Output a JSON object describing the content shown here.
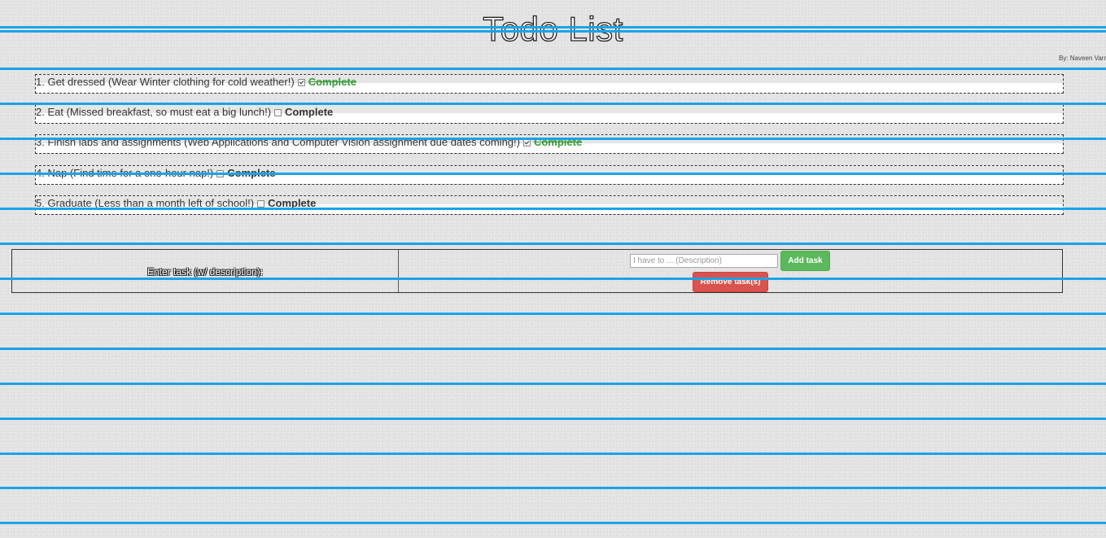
{
  "header": {
    "title": "Todo List",
    "author": "By: Naveen Varma"
  },
  "tasks": [
    {
      "number": "1.",
      "text": "Get dressed (Wear Winter clothing for cold weather!)",
      "checked": true,
      "status_label": "Complete"
    },
    {
      "number": "2.",
      "text": "Eat (Missed breakfast, so must eat a big lunch!)",
      "checked": false,
      "status_label": "Complete"
    },
    {
      "number": "3.",
      "text": "Finish labs and assignments (Web Applications and Computer Vision assignment due dates coming!)",
      "checked": true,
      "status_label": "Complete"
    },
    {
      "number": "4.",
      "text": "Nap (Find time for a one-hour nap!)",
      "checked": false,
      "status_label": "Complete"
    },
    {
      "number": "5.",
      "text": "Graduate (Less than a month left of school!)",
      "checked": false,
      "status_label": "Complete"
    }
  ],
  "form": {
    "label": "Enter task (w/ description):",
    "input_placeholder": "I have to ... (Description)",
    "input_value": "",
    "add_button_label": "Add task",
    "remove_button_label": "Remove task(s)"
  },
  "colors": {
    "ruled_line": "#1aa3e8",
    "complete_done": "#3a9a3a",
    "add_button": "#5cb85c",
    "remove_button": "#d9534f"
  }
}
